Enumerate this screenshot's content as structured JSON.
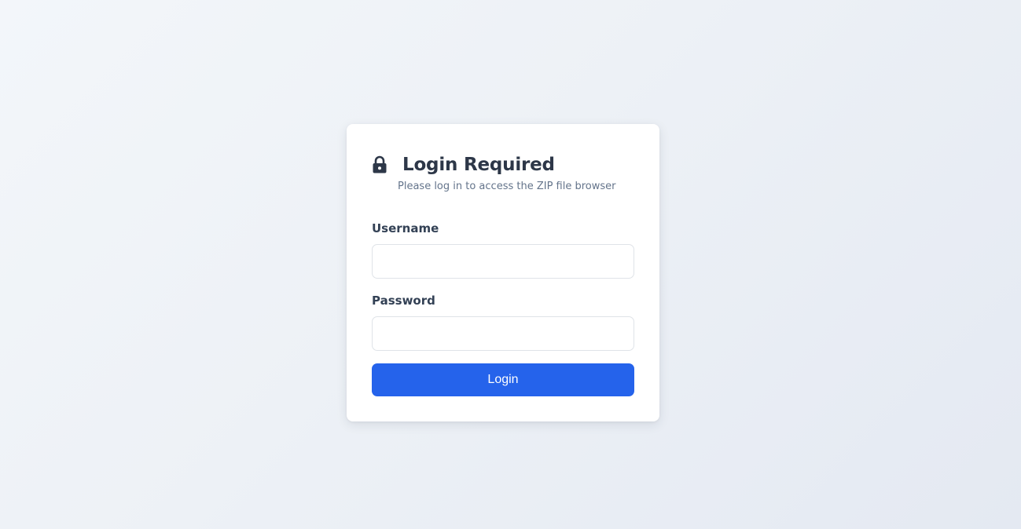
{
  "login": {
    "title": "Login Required",
    "subtitle": "Please log in to access the ZIP file browser",
    "icon": "lock-icon",
    "username": {
      "label": "Username",
      "value": "",
      "placeholder": ""
    },
    "password": {
      "label": "Password",
      "value": "",
      "placeholder": ""
    },
    "submit_label": "Login"
  },
  "colors": {
    "accent": "#2563eb",
    "title": "#2d3748",
    "subtitle": "#64748b",
    "card_background": "#ffffff",
    "page_background": "#edf1f6"
  }
}
